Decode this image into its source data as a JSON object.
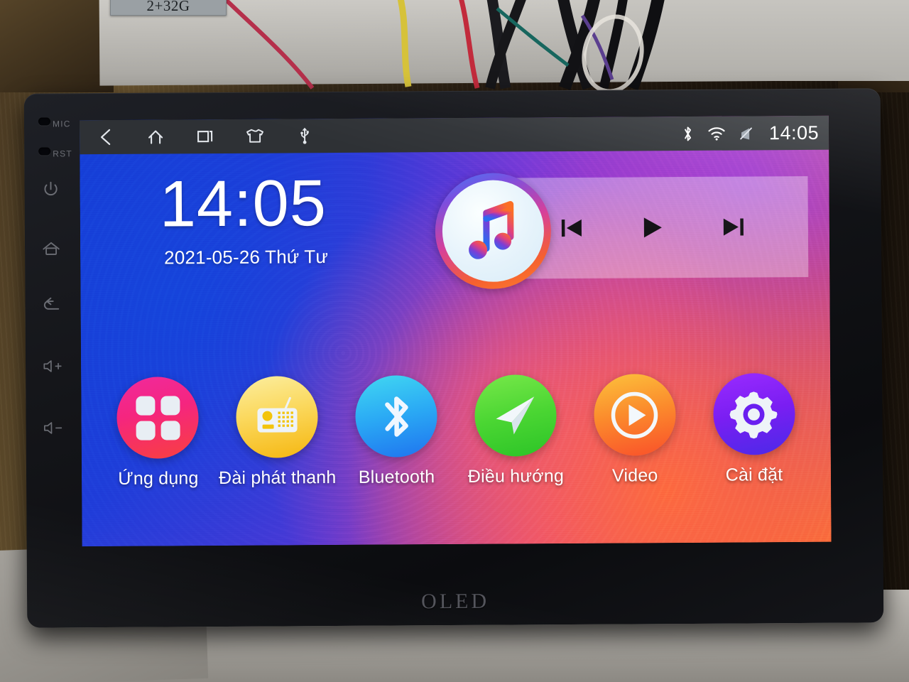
{
  "device": {
    "brand_label": "OLED",
    "sticker_label": "2+32G",
    "side_keys": [
      {
        "name": "mic",
        "label": "MIC"
      },
      {
        "name": "reset",
        "label": "RST"
      },
      {
        "name": "power",
        "label": "⏻"
      },
      {
        "name": "home",
        "label": "⌂"
      },
      {
        "name": "back",
        "label": "↰"
      },
      {
        "name": "volume-up",
        "label": "+"
      },
      {
        "name": "volume-down",
        "label": "−"
      }
    ]
  },
  "status_bar": {
    "nav": [
      {
        "name": "back",
        "label": "back-icon"
      },
      {
        "name": "home",
        "label": "home-icon"
      },
      {
        "name": "recents",
        "label": "recents-icon"
      },
      {
        "name": "theme",
        "label": "tshirt-icon"
      },
      {
        "name": "usb",
        "label": "usb-icon"
      }
    ],
    "indicators": [
      {
        "name": "bluetooth",
        "label": "bluetooth-icon"
      },
      {
        "name": "wifi",
        "label": "wifi-icon"
      },
      {
        "name": "signal-mute",
        "label": "signal-mute-icon"
      }
    ],
    "time": "14:05",
    "background": "#2e3135"
  },
  "clock_widget": {
    "time": "14:05",
    "date": "2021-05-26",
    "weekday": "Thứ Tư",
    "date_line": "2021-05-26  Thứ Tư"
  },
  "music_widget": {
    "icon": "music-note-icon",
    "controls": [
      {
        "name": "previous",
        "glyph": "prev-track-icon"
      },
      {
        "name": "play",
        "glyph": "play-icon"
      },
      {
        "name": "next",
        "glyph": "next-track-icon"
      }
    ]
  },
  "dock": {
    "apps": [
      {
        "id": "apps",
        "label": "Ứng dụng",
        "icon": "grid-icon",
        "color": "#f3297f"
      },
      {
        "id": "radio",
        "label": "Đài phát thanh",
        "icon": "radio-icon",
        "color": "#fbd85c"
      },
      {
        "id": "bluetooth",
        "label": "Bluetooth",
        "icon": "bluetooth-icon",
        "color": "#2aa8f4"
      },
      {
        "id": "navigation",
        "label": "Điều hướng",
        "icon": "navigation-icon",
        "color": "#4bd633"
      },
      {
        "id": "video",
        "label": "Video",
        "icon": "play-circle-icon",
        "color": "#fb8a2c"
      },
      {
        "id": "settings",
        "label": "Cài đặt",
        "icon": "gear-icon",
        "color": "#7a1ef2"
      }
    ]
  },
  "wallpaper": {
    "colors": [
      "#1436d0",
      "#7232d2",
      "#d2379f",
      "#f1564f",
      "#fa7238"
    ]
  }
}
